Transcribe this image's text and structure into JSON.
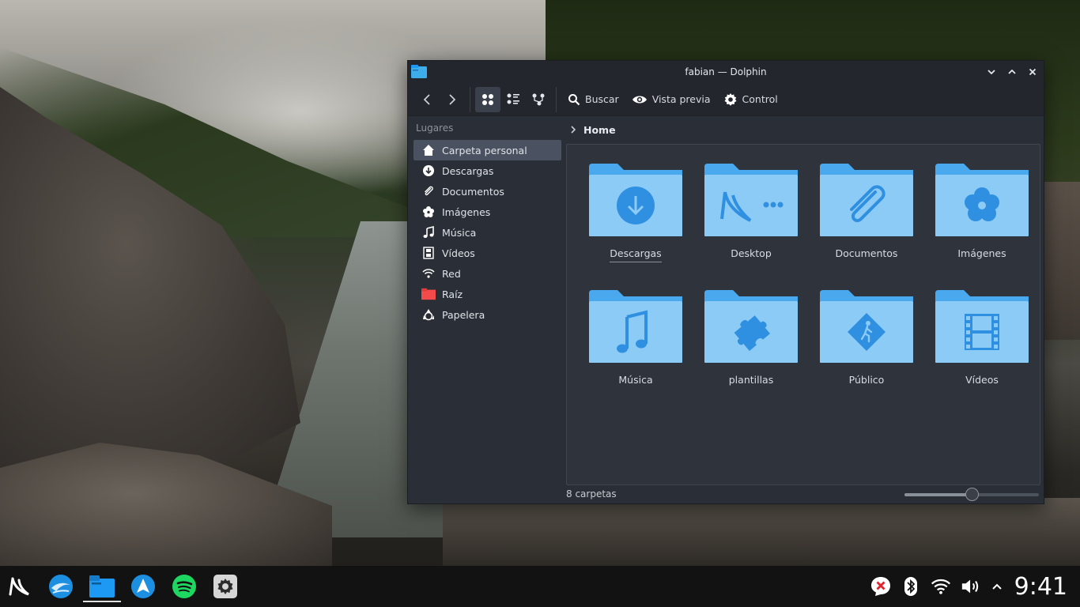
{
  "window": {
    "title": "fabian — Dolphin"
  },
  "toolbar": {
    "search_label": "Buscar",
    "preview_label": "Vista previa",
    "control_label": "Control"
  },
  "sidebar": {
    "heading": "Lugares",
    "items": [
      {
        "label": "Carpeta personal",
        "icon": "home-icon",
        "selected": true
      },
      {
        "label": "Descargas",
        "icon": "download-icon"
      },
      {
        "label": "Documentos",
        "icon": "paperclip-icon"
      },
      {
        "label": "Imágenes",
        "icon": "flower-icon"
      },
      {
        "label": "Música",
        "icon": "music-note-icon"
      },
      {
        "label": "Vídeos",
        "icon": "film-icon"
      },
      {
        "label": "Red",
        "icon": "wifi-icon"
      },
      {
        "label": "Raíz",
        "icon": "red-folder-icon"
      },
      {
        "label": "Papelera",
        "icon": "recycle-icon"
      }
    ]
  },
  "breadcrumb": {
    "current": "Home"
  },
  "files": [
    {
      "name": "Descargas",
      "icon": "download-icon",
      "focused": true
    },
    {
      "name": "Desktop",
      "icon": "kde-desktop-icon"
    },
    {
      "name": "Documentos",
      "icon": "paperclip-icon"
    },
    {
      "name": "Imágenes",
      "icon": "flower-icon"
    },
    {
      "name": "Música",
      "icon": "music-note-icon"
    },
    {
      "name": "plantillas",
      "icon": "puzzle-icon"
    },
    {
      "name": "Público",
      "icon": "public-walk-icon"
    },
    {
      "name": "Vídeos",
      "icon": "film-icon"
    }
  ],
  "status": {
    "text": "8 carpetas",
    "zoom_level": 0.5
  },
  "taskbar": {
    "apps": [
      "kde-launcher-icon",
      "browser-icon",
      "dolphin-icon",
      "discover-icon",
      "spotify-icon",
      "settings-icon"
    ],
    "clock": "9:41"
  },
  "colors": {
    "folder_light": "#8ccbf5",
    "folder_tab": "#4aa8ee",
    "glyph": "#2f8fe0",
    "selection": "#4a5160"
  }
}
